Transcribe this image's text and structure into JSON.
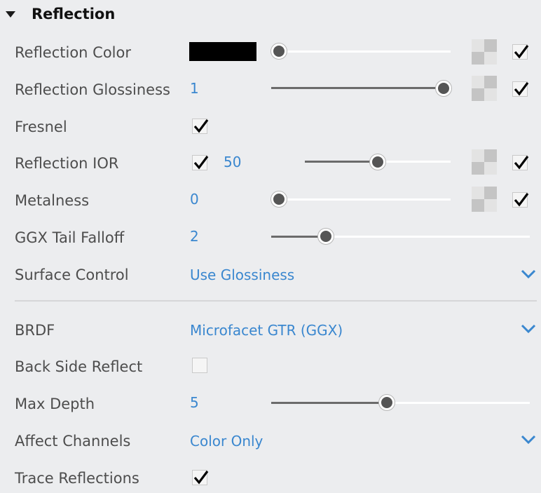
{
  "section": {
    "title": "Reflection",
    "expanded": true
  },
  "rows": {
    "reflection_color": {
      "label": "Reflection Color",
      "color": "#000000",
      "slider_fraction": 0.0,
      "map_enabled": true
    },
    "reflection_glossiness": {
      "label": "Reflection Glossiness",
      "value": "1",
      "slider_fraction": 1.0,
      "map_enabled": true
    },
    "fresnel": {
      "label": "Fresnel",
      "checked": true
    },
    "reflection_ior": {
      "label": "Reflection IOR",
      "checked": true,
      "value": "50",
      "slider_fraction": 0.5,
      "map_enabled": true
    },
    "metalness": {
      "label": "Metalness",
      "value": "0",
      "slider_fraction": 0.0,
      "map_enabled": true
    },
    "ggx_tail_falloff": {
      "label": "GGX Tail Falloff",
      "value": "2",
      "slider_fraction": 0.21
    },
    "surface_control": {
      "label": "Surface Control",
      "value": "Use Glossiness"
    },
    "brdf": {
      "label": "BRDF",
      "value": "Microfacet GTR (GGX)"
    },
    "back_side_reflect": {
      "label": "Back Side Reflect",
      "checked": false
    },
    "max_depth": {
      "label": "Max Depth",
      "value": "5",
      "slider_fraction": 0.45
    },
    "affect_channels": {
      "label": "Affect Channels",
      "value": "Color Only"
    },
    "trace_reflections": {
      "label": "Trace Reflections",
      "checked": true
    }
  },
  "colors": {
    "accent": "#3a87cf",
    "label": "#4d4d4d",
    "background": "#ecedef"
  },
  "icons": {
    "collapse": "triangle-down-icon",
    "check": "checkmark-icon",
    "texture": "checkerboard-texture-icon",
    "dropdown": "chevron-down-icon"
  }
}
